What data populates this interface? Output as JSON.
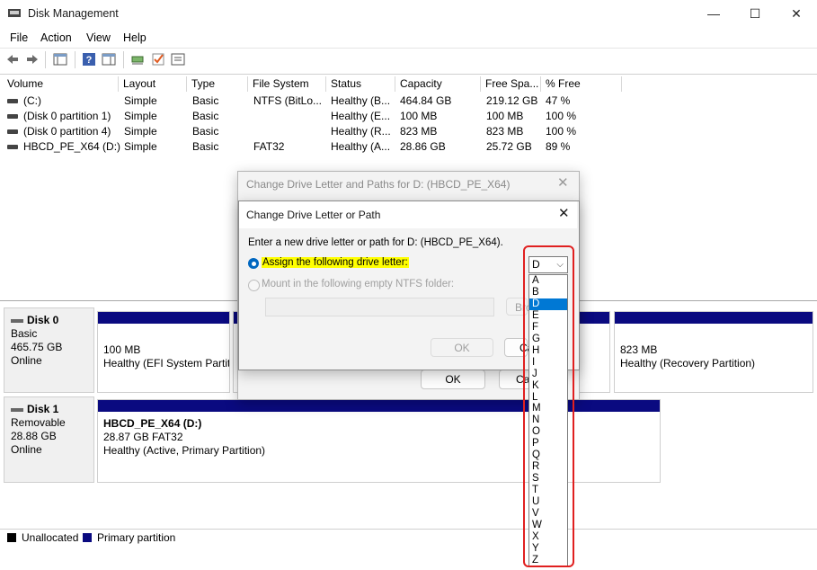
{
  "window": {
    "title": "Disk Management",
    "minimize": "—",
    "maximize": "☐",
    "close": "✕"
  },
  "menu": [
    "File",
    "Action",
    "View",
    "Help"
  ],
  "toolbar": {
    "icons": [
      "back-arrow-icon",
      "forward-arrow-icon",
      "console-tree-icon",
      "help-icon",
      "action-pane-icon",
      "connect-icon",
      "check-icon",
      "properties-icon"
    ]
  },
  "volume_list": {
    "columns": [
      "Volume",
      "Layout",
      "Type",
      "File System",
      "Status",
      "Capacity",
      "Free Spa...",
      "% Free"
    ],
    "rows": [
      [
        "(C:)",
        "Simple",
        "Basic",
        "NTFS (BitLo...",
        "Healthy (B...",
        "464.84 GB",
        "219.12 GB",
        "47 %"
      ],
      [
        "(Disk 0 partition 1)",
        "Simple",
        "Basic",
        "",
        "Healthy (E...",
        "100 MB",
        "100 MB",
        "100 %"
      ],
      [
        "(Disk 0 partition 4)",
        "Simple",
        "Basic",
        "",
        "Healthy (R...",
        "823 MB",
        "823 MB",
        "100 %"
      ],
      [
        "HBCD_PE_X64 (D:)",
        "Simple",
        "Basic",
        "FAT32",
        "Healthy (A...",
        "28.86 GB",
        "25.72 GB",
        "89 %"
      ]
    ]
  },
  "disks": [
    {
      "name": "Disk 0",
      "kind": "Basic",
      "size": "465.75 GB",
      "state": "Online",
      "partitions": [
        {
          "size": "100 MB",
          "status": "Healthy (EFI System Partit"
        },
        {
          "size": "823 MB",
          "status": "Healthy (Recovery Partition)"
        }
      ]
    },
    {
      "name": "Disk 1",
      "kind": "Removable",
      "size": "28.88 GB",
      "state": "Online",
      "partitions": [
        {
          "name": "HBCD_PE_X64  (D:)",
          "size": "28.87 GB FAT32",
          "status": "Healthy (Active, Primary Partition)"
        }
      ]
    }
  ],
  "legend": {
    "unallocated": "Unallocated",
    "primary": "Primary partition"
  },
  "colors": {
    "primary_bar": "#0a0a80",
    "unallocated": "#000000",
    "highlight": "#ffff00",
    "selection": "#0078d4",
    "outline": "#e02020"
  },
  "outer_dialog": {
    "title": "Change Drive Letter and Paths for D: (HBCD_PE_X64)",
    "ok": "OK",
    "cancel": "Ca"
  },
  "inner_dialog": {
    "title": "Change Drive Letter or Path",
    "prompt": "Enter a new drive letter or path for D: (HBCD_PE_X64).",
    "option_assign": "Assign the following drive letter:",
    "option_mount": "Mount in the following empty NTFS folder:",
    "browse": "Bro",
    "ok": "OK",
    "cancel": "Ca",
    "selected_letter": "D",
    "letters": [
      "A",
      "B",
      "D",
      "E",
      "F",
      "G",
      "H",
      "I",
      "J",
      "K",
      "L",
      "M",
      "N",
      "O",
      "P",
      "Q",
      "R",
      "S",
      "T",
      "U",
      "V",
      "W",
      "X",
      "Y",
      "Z"
    ]
  }
}
